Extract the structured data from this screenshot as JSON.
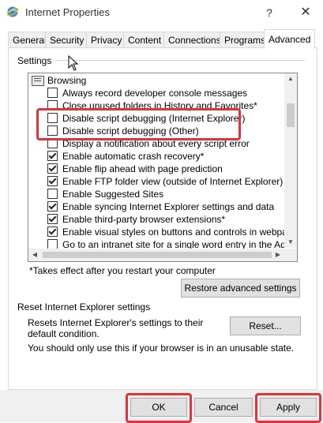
{
  "window": {
    "title": "Internet Properties",
    "help": "?",
    "close": "✕"
  },
  "tabs": [
    {
      "label": "General"
    },
    {
      "label": "Security"
    },
    {
      "label": "Privacy"
    },
    {
      "label": "Content"
    },
    {
      "label": "Connections"
    },
    {
      "label": "Programs"
    },
    {
      "label": "Advanced"
    }
  ],
  "settings": {
    "group_label": "Settings",
    "category": "Browsing",
    "items": [
      {
        "label": "Always record developer console messages",
        "checked": false
      },
      {
        "label": "Close unused folders in History and Favorites*",
        "checked": false
      },
      {
        "label": "Disable script debugging (Internet Explorer)",
        "checked": false
      },
      {
        "label": "Disable script debugging (Other)",
        "checked": false
      },
      {
        "label": "Display a notification about every script error",
        "checked": false
      },
      {
        "label": "Enable automatic crash recovery*",
        "checked": true
      },
      {
        "label": "Enable flip ahead with page prediction",
        "checked": true
      },
      {
        "label": "Enable FTP folder view (outside of Internet Explorer)",
        "checked": true
      },
      {
        "label": "Enable Suggested Sites",
        "checked": false
      },
      {
        "label": "Enable syncing Internet Explorer settings and data",
        "checked": true
      },
      {
        "label": "Enable third-party browser extensions*",
        "checked": true
      },
      {
        "label": "Enable visual styles on buttons and controls in webpages",
        "checked": true
      },
      {
        "label": "Go to an intranet site for a single word entry in the Address",
        "checked": false
      }
    ],
    "note": "*Takes effect after you restart your computer",
    "restore_label": "Restore advanced settings"
  },
  "reset": {
    "group_label": "Reset Internet Explorer settings",
    "description": "Resets Internet Explorer's settings to their default condition.",
    "button_label": "Reset...",
    "warning": "You should only use this if your browser is in an unusable state."
  },
  "footer": {
    "ok_label": "OK",
    "cancel_label": "Cancel",
    "apply_label": "Apply"
  },
  "colors": {
    "highlight": "#e0343c",
    "button_face": "#e1e1e1"
  }
}
